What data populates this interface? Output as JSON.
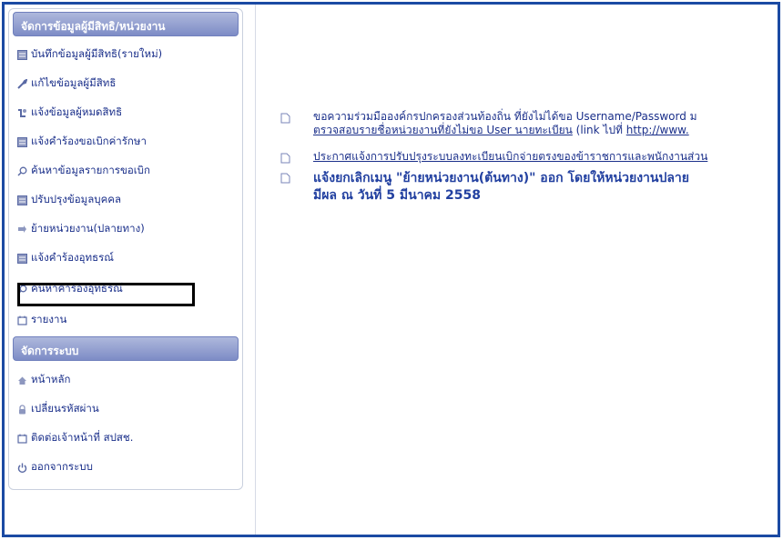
{
  "sidebar": {
    "section1_title": "จัดการข้อมูลผู้มีสิทธิ/หน่วยงาน",
    "items1": [
      {
        "label": "บันทึกข้อมูลผู้มีสิทธิ(รายใหม่)",
        "icon": "form-icon"
      },
      {
        "label": "แก้ไขข้อมูลผู้มีสิทธิ",
        "icon": "wrench-icon"
      },
      {
        "label": "แจ้งข้อมูลผู้หมดสิทธิ",
        "icon": "notify-icon"
      },
      {
        "label": "แจ้งคำร้องขอเบิกค่ารักษา",
        "icon": "form-icon"
      },
      {
        "label": "ค้นหาข้อมูลรายการขอเบิก",
        "icon": "search-icon"
      },
      {
        "label": "ปรับปรุงข้อมูลบุคคล",
        "icon": "form-icon"
      },
      {
        "label": "ย้ายหน่วยงาน(ปลายทาง)",
        "icon": "move-icon"
      },
      {
        "label": "แจ้งคำร้องอุทธรณ์",
        "icon": "form-icon"
      },
      {
        "label": "ค้นหาคำร้องอุทธรณ์",
        "icon": "search-icon"
      },
      {
        "label": "รายงาน",
        "icon": "report-icon"
      }
    ],
    "section2_title": "จัดการระบบ",
    "items2": [
      {
        "label": "หน้าหลัก",
        "icon": "home-icon"
      },
      {
        "label": "เปลี่ยนรหัสผ่าน",
        "icon": "lock-icon"
      },
      {
        "label": "ติดต่อเจ้าหน้าที่ สปสช.",
        "icon": "contact-icon"
      },
      {
        "label": "ออกจากระบบ",
        "icon": "power-icon"
      }
    ]
  },
  "news": {
    "item1_line1": "ขอความร่วมมือองค์กรปกครองส่วนท้องถิ่น ที่ยังไม่ได้ขอ Username/Password ม",
    "item1_line2_link": "ตรวจสอบรายชื่อหน่วยงานที่ยังไม่ขอ User นายทะเบียน",
    "item1_line2_rest": " (link ไปที่ ",
    "item1_line2_url": "http://www.",
    "item2": "ประกาศแจ้งการปรับปรุงระบบลงทะเบียนเบิกจ่ายตรงของข้าราชการและพนักงานส่วน",
    "item3_line1": "แจ้งยกเลิกเมนู \"ย้ายหน่วยงาน(ต้นทาง)\" ออก โดยให้หน่วยงานปลาย",
    "item3_line2": "มีผล ณ วันที่ 5 มีนาคม 2558"
  },
  "colors": {
    "frame": "#1b4aa3",
    "header_bg": "#8e9bd0",
    "text": "#1a2f8a"
  }
}
